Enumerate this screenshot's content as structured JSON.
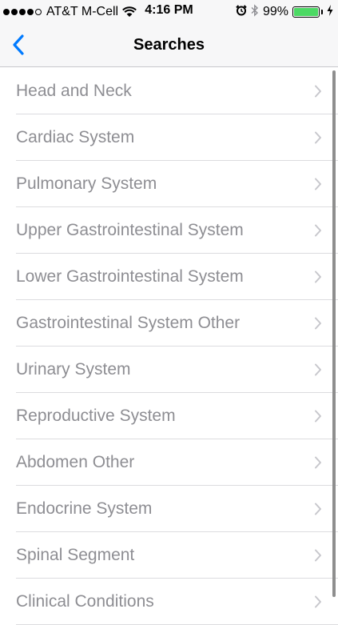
{
  "status_bar": {
    "carrier": "AT&T M-Cell",
    "time": "4:16 PM",
    "battery": "99%",
    "battery_level": 0.99,
    "signal_dots": 5,
    "signal_filled": 4
  },
  "nav": {
    "title": "Searches",
    "back_icon": "chevron-left-icon"
  },
  "colors": {
    "accent": "#007aff",
    "row_text": "#8e8e93",
    "separator": "#dcdcdf",
    "battery": "#4cd964"
  },
  "items": [
    {
      "label": "Head and Neck"
    },
    {
      "label": "Cardiac System"
    },
    {
      "label": "Pulmonary System"
    },
    {
      "label": "Upper Gastrointestinal System"
    },
    {
      "label": "Lower Gastrointestinal System"
    },
    {
      "label": "Gastrointestinal System Other"
    },
    {
      "label": "Urinary System"
    },
    {
      "label": "Reproductive System"
    },
    {
      "label": "Abdomen Other"
    },
    {
      "label": "Endocrine System"
    },
    {
      "label": "Spinal Segment"
    },
    {
      "label": "Clinical Conditions"
    }
  ]
}
